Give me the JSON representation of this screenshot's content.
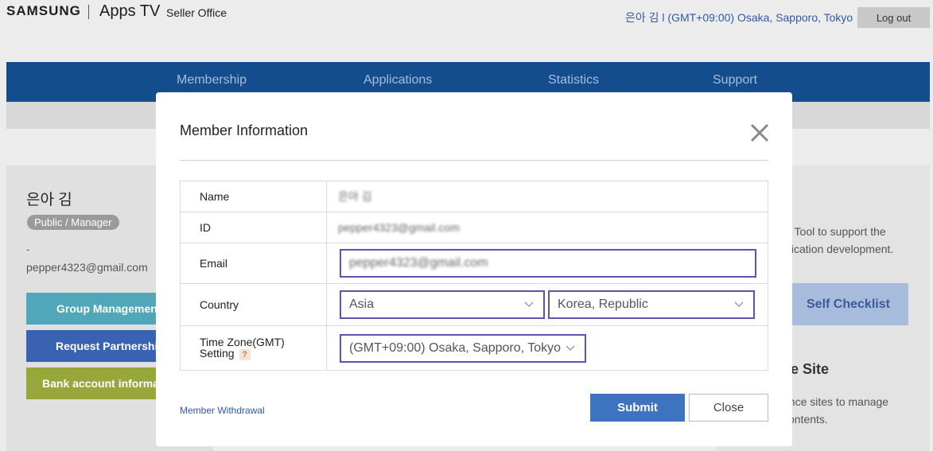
{
  "header": {
    "brand": "SAMSUNG",
    "product": "Apps TV",
    "subtitle": "Seller Office",
    "user_info": "은아 김 l (GMT+09:00) Osaka, Sapporo, Tokyo",
    "logout_label": "Log out"
  },
  "nav": {
    "items": [
      {
        "label": "Membership"
      },
      {
        "label": "Applications"
      },
      {
        "label": "Statistics"
      },
      {
        "label": "Support"
      }
    ]
  },
  "sidebar": {
    "user_name": "은아 김",
    "role_badge": "Public / Manager",
    "dash": "-",
    "email": "pepper4323@gmail.com",
    "buttons": [
      {
        "label": "Group Management"
      },
      {
        "label": "Request Partnership"
      },
      {
        "label": "Bank account information"
      }
    ]
  },
  "right_panel": {
    "text1_line1": "st Tool to support the",
    "text1_line2": "plication development.",
    "checklist_label": "Self Checklist",
    "section_title": "ce Site",
    "text2_line1": "ence sites to manage",
    "text2_line2": "contents."
  },
  "modal": {
    "title": "Member Information",
    "rows": {
      "name_label": "Name",
      "name_value": "은아 김",
      "id_label": "ID",
      "id_value": "pepper4323@gmail.com",
      "email_label": "Email",
      "email_value": "pepper4323@gmail.com",
      "country_label": "Country",
      "continent_value": "Asia",
      "country_value": "Korea, Republic",
      "timezone_label_line1": "Time Zone(GMT)",
      "timezone_label_line2": "Setting",
      "timezone_help": "?",
      "timezone_value": "(GMT+09:00) Osaka, Sapporo, Tokyo"
    },
    "withdraw_label": "Member Withdrawal",
    "submit_label": "Submit",
    "close_label": "Close"
  },
  "colors": {
    "nav_bg": "#134d8e",
    "submit_bg": "#3e73c0",
    "field_border": "#5a55b5",
    "link": "#2f5aa8"
  }
}
